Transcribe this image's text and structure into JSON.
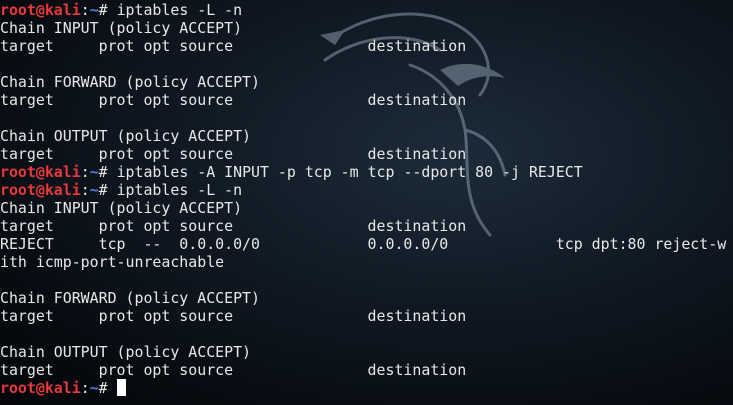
{
  "prompt": {
    "user": "root@kali",
    "colon": ":",
    "path": "~",
    "symbol": "# "
  },
  "lines": [
    {
      "type": "cmd",
      "text": "iptables -L -n"
    },
    {
      "type": "out",
      "text": "Chain INPUT (policy ACCEPT)"
    },
    {
      "type": "out",
      "text": "target     prot opt source               destination"
    },
    {
      "type": "out",
      "text": ""
    },
    {
      "type": "out",
      "text": "Chain FORWARD (policy ACCEPT)"
    },
    {
      "type": "out",
      "text": "target     prot opt source               destination"
    },
    {
      "type": "out",
      "text": ""
    },
    {
      "type": "out",
      "text": "Chain OUTPUT (policy ACCEPT)"
    },
    {
      "type": "out",
      "text": "target     prot opt source               destination"
    },
    {
      "type": "cmd",
      "text": "iptables -A INPUT -p tcp -m tcp --dport 80 -j REJECT"
    },
    {
      "type": "cmd",
      "text": "iptables -L -n"
    },
    {
      "type": "out",
      "text": "Chain INPUT (policy ACCEPT)"
    },
    {
      "type": "out",
      "text": "target     prot opt source               destination"
    },
    {
      "type": "out",
      "text": "REJECT     tcp  --  0.0.0.0/0            0.0.0.0/0            tcp dpt:80 reject-w"
    },
    {
      "type": "out",
      "text": "ith icmp-port-unreachable"
    },
    {
      "type": "out",
      "text": ""
    },
    {
      "type": "out",
      "text": "Chain FORWARD (policy ACCEPT)"
    },
    {
      "type": "out",
      "text": "target     prot opt source               destination"
    },
    {
      "type": "out",
      "text": ""
    },
    {
      "type": "out",
      "text": "Chain OUTPUT (policy ACCEPT)"
    },
    {
      "type": "out",
      "text": "target     prot opt source               destination"
    },
    {
      "type": "prompt",
      "text": ""
    }
  ],
  "colors": {
    "user": "#e83a3a",
    "path": "#4f7fe8",
    "text": "#e8e8e8",
    "cursor": "#ffffff"
  },
  "icons": {
    "background": "kali-dragon-watermark"
  }
}
